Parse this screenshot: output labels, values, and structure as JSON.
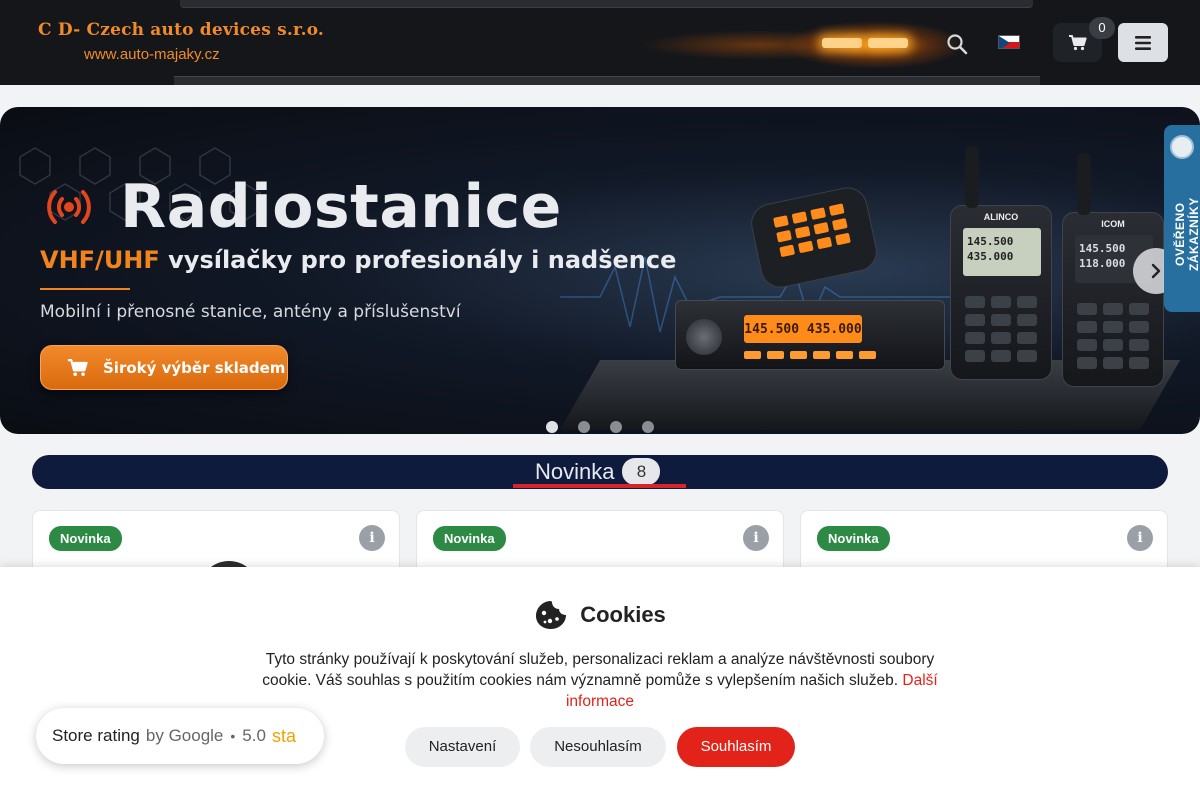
{
  "header": {
    "logo_title": "C D- Czech auto devices s.r.o.",
    "logo_url": "www.auto-majaky.cz",
    "cart_count": "0",
    "language": "cs"
  },
  "hero": {
    "title": "Radiostanice",
    "subtitle_accent": "VHF/UHF",
    "subtitle_rest": " vysílačky pro profesionály i nadšence",
    "description": "Mobilní i přenosné stanice, antény a příslušenství",
    "cta_label": "Široký výběr skladem",
    "mobile_display": "145.500  435.000",
    "handheld_a_brand": "ALINCO",
    "handheld_a_line1": "145.500",
    "handheld_a_line2": "435.000",
    "handheld_b_brand": "ICOM",
    "handheld_b_line1": "145.500",
    "handheld_b_line2": "118.000",
    "slides_total": 4,
    "active_slide": 1
  },
  "verified_badge": "OVĚŘENO ZÁKAZNÍKY",
  "section": {
    "title": "Novinka",
    "count": "8"
  },
  "cards": [
    {
      "badge": "Novinka"
    },
    {
      "badge": "Novinka"
    },
    {
      "badge": "Novinka"
    }
  ],
  "cookies": {
    "title": "Cookies",
    "text": "Tyto stránky používají k poskytování služeb, personalizaci reklam a analýze návštěvnosti soubory cookie. Váš souhlas s použitím cookies nám významně pomůže s vylepšením našich služeb.",
    "more_link": "Další informace",
    "btn_settings": "Nastavení",
    "btn_reject": "Nesouhlasím",
    "btn_accept": "Souhlasím"
  },
  "rating": {
    "label": "Store rating",
    "by": "by Google",
    "score": "5.0",
    "stars_label": "sta"
  },
  "colors": {
    "accent_orange": "#f2841d",
    "accept_red": "#e2231a",
    "badge_green": "#2d8a45",
    "section_navy": "#0f1b3d"
  }
}
